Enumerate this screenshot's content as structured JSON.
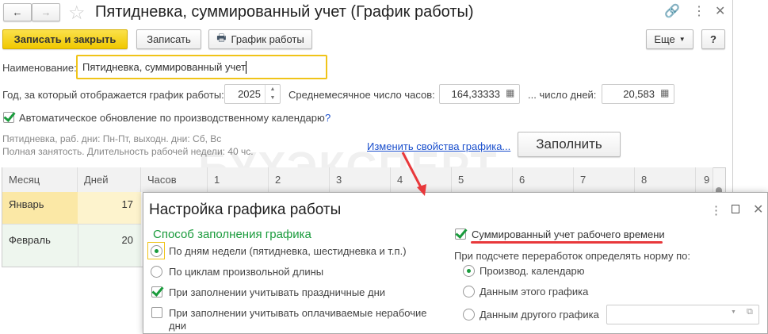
{
  "window": {
    "title": "Пятидневка, суммированный учет (График работы)"
  },
  "toolbar": {
    "save_close": "Записать и закрыть",
    "save": "Записать",
    "schedule": "График работы",
    "more": "Еще",
    "help": "?"
  },
  "form": {
    "name_label": "Наименование:",
    "name_value": "Пятидневка, суммированный учет",
    "year_label": "Год, за который отображается график работы:",
    "year_value": "2025",
    "avg_hours_label": "Среднемесячное число часов:",
    "avg_hours_value": "164,33333",
    "avg_days_label": "... число дней:",
    "avg_days_value": "20,583",
    "auto_update_label": "Автоматическое обновление по производственному календарю",
    "auto_update_checked": true,
    "help_mark": "?",
    "info_line1": "Пятидневка, раб. дни: Пн-Пт, выходн. дни: Сб, Вс",
    "info_line2": "Полная занятость. Длительность рабочей недели: 40 чс.",
    "change_link": "Изменить свойства графика...",
    "fill_button": "Заполнить"
  },
  "table": {
    "headers": [
      "Месяц",
      "Дней",
      "Часов",
      "1",
      "2",
      "3",
      "4",
      "5",
      "6",
      "7",
      "8",
      "9"
    ],
    "rows": [
      {
        "month": "Январь",
        "days": "17"
      },
      {
        "month": "Февраль",
        "days": "20"
      }
    ]
  },
  "watermark": "БУХЭКСПЕРТ",
  "dialog": {
    "title": "Настройка графика работы",
    "section": "Способ заполнения графика",
    "opt_weekdays": "По дням недели (пятидневка, шестидневка и т.п.)",
    "opt_cycles": "По циклам произвольной длины",
    "chk_holidays": "При заполнении учитывать праздничные дни",
    "chk_holidays_checked": true,
    "chk_paid_line1": "При заполнении учитывать оплачиваемые нерабочие",
    "chk_paid_line2": "дни",
    "chk_paid_checked": false,
    "chk_summed": "Суммированный учет рабочего времени",
    "chk_summed_checked": true,
    "norm_label": "При подсчете переработок определять норму по:",
    "norm_calendar": "Производ. календарю",
    "norm_this": "Данным этого графика",
    "norm_other": "Данным другого графика",
    "other_value": ""
  },
  "colors": {
    "accent_yellow": "#f5d327",
    "link": "#1a4fcc",
    "green": "#1a9b3c",
    "annotation_red": "#e8383b",
    "row_selected": "#fbe8a6",
    "row_alt": "#eef6ee"
  }
}
